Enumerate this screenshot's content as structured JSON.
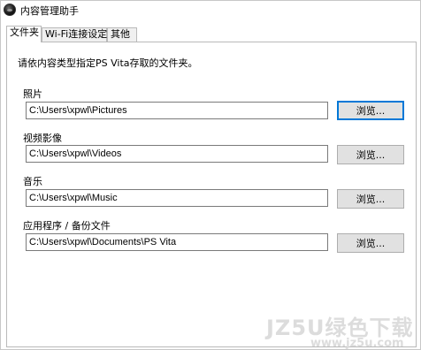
{
  "window": {
    "title": "内容管理助手"
  },
  "tabs": [
    {
      "label": "文件夹",
      "active": true
    },
    {
      "label": "Wi-Fi连接设定",
      "active": false
    },
    {
      "label": "其他",
      "active": false
    }
  ],
  "instruction": "请依内容类型指定PS Vita存取的文件夹。",
  "folders": [
    {
      "label": "照片",
      "path": "C:\\Users\\xpwl\\Pictures",
      "button": "浏览..."
    },
    {
      "label": "视频影像",
      "path": "C:\\Users\\xpwl\\Videos",
      "button": "浏览..."
    },
    {
      "label": "音乐",
      "path": "C:\\Users\\xpwl\\Music",
      "button": "浏览..."
    },
    {
      "label": "应用程序 / 备份文件",
      "path": "C:\\Users\\xpwl\\Documents\\PS Vita",
      "button": "浏览..."
    }
  ],
  "watermark": {
    "main": "JZ5U绿色下载",
    "sub": "www.jz5u.com"
  },
  "colors": {
    "focus_border": "#0078d7",
    "button_bg": "#e1e1e1"
  }
}
